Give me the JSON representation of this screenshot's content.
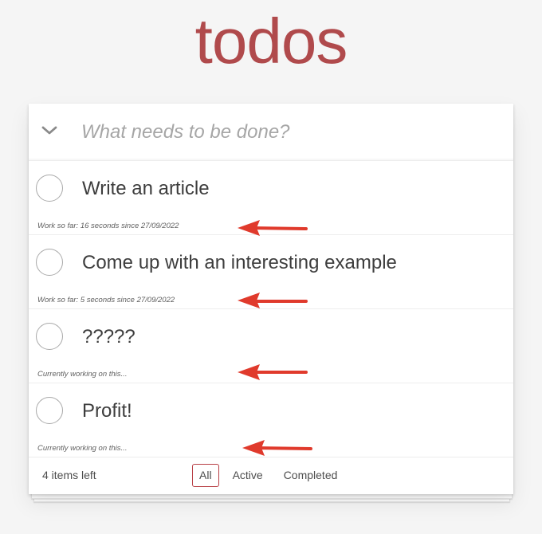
{
  "header": {
    "title": "todos"
  },
  "new_todo": {
    "placeholder": "What needs to be done?"
  },
  "todos": [
    {
      "label": "Write an article",
      "note": "Work so far: 16 seconds since 27/09/2022",
      "completed": false
    },
    {
      "label": "Come up with an interesting example",
      "note": "Work so far: 5 seconds since 27/09/2022",
      "completed": false
    },
    {
      "label": "?????",
      "note": "Currently working on this...",
      "completed": false
    },
    {
      "label": "Profit!",
      "note": "Currently working on this...",
      "completed": false
    }
  ],
  "footer": {
    "items_left": "4 items left",
    "filters": [
      {
        "label": "All",
        "selected": true
      },
      {
        "label": "Active",
        "selected": false
      },
      {
        "label": "Completed",
        "selected": false
      }
    ]
  },
  "colors": {
    "title": "#b04a4c",
    "annotation_arrow": "#e03a2c",
    "selected_filter_border": "#b83f45"
  },
  "icons": {
    "toggle_all": "chevron-down-icon",
    "todo_check": "circle-checkbox-icon",
    "annotation": "left-arrow-icon"
  }
}
